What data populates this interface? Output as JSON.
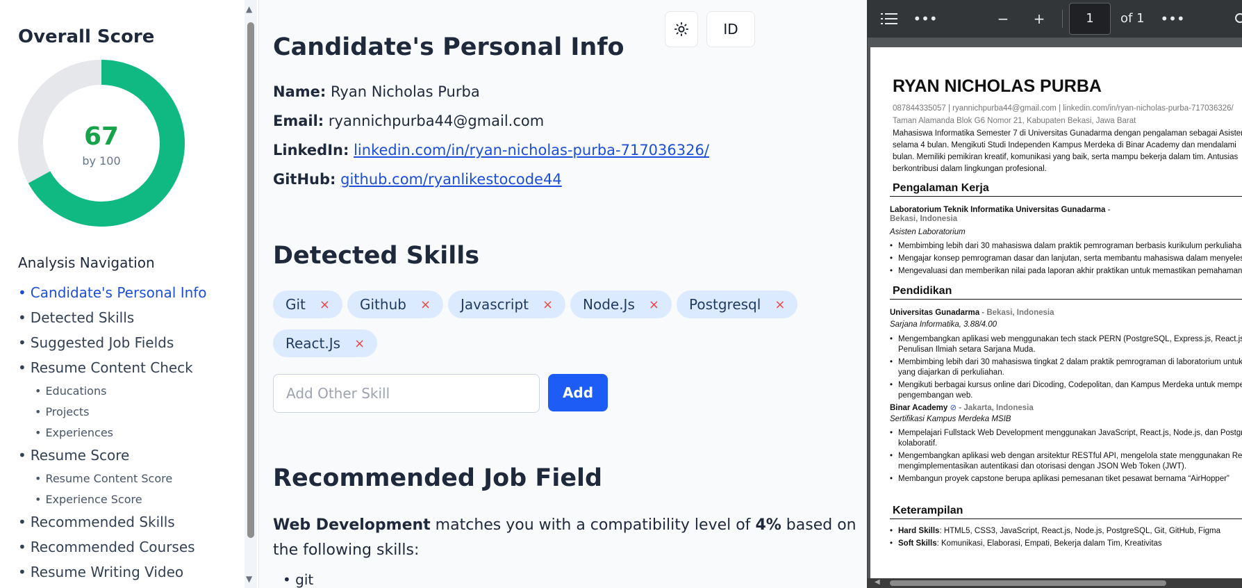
{
  "sidebar": {
    "score_title": "Overall Score",
    "score_value": "67",
    "score_max_label": "by 100",
    "score_fraction": 0.67,
    "score_color": "#10b981",
    "score_track_color": "#e5e7eb",
    "nav_title": "Analysis Navigation",
    "nav_items": [
      {
        "label": "Candidate's Personal Info",
        "level": 1,
        "active": true
      },
      {
        "label": "Detected Skills",
        "level": 1
      },
      {
        "label": "Suggested Job Fields",
        "level": 1
      },
      {
        "label": "Resume Content Check",
        "level": 1
      },
      {
        "label": "Educations",
        "level": 2
      },
      {
        "label": "Projects",
        "level": 2
      },
      {
        "label": "Experiences",
        "level": 2
      },
      {
        "label": "Resume Score",
        "level": 1
      },
      {
        "label": "Resume Content Score",
        "level": 2
      },
      {
        "label": "Experience Score",
        "level": 2
      },
      {
        "label": "Recommended Skills",
        "level": 1
      },
      {
        "label": "Recommended Courses",
        "level": 1
      },
      {
        "label": "Resume Writing Video",
        "level": 1
      }
    ]
  },
  "header": {
    "theme_icon": "sun-icon",
    "language_label": "ID"
  },
  "personal_info": {
    "title": "Candidate's Personal Info",
    "name_label": "Name:",
    "name_value": "Ryan Nicholas Purba",
    "email_label": "Email:",
    "email_value": "ryannichpurba44@gmail.com",
    "linkedin_label": "LinkedIn:",
    "linkedin_value": "linkedin.com/in/ryan-nicholas-purba-717036326/",
    "github_label": "GitHub:",
    "github_value": "github.com/ryanlikestocode44"
  },
  "skills": {
    "title": "Detected Skills",
    "chips": [
      "Git",
      "Github",
      "Javascript",
      "Node.Js",
      "Postgresql",
      "React.Js"
    ],
    "remove_symbol": "×",
    "input_placeholder": "Add Other Skill",
    "add_label": "Add"
  },
  "job_field": {
    "title": "Recommended Job Field",
    "field": "Web Development",
    "text_before": " matches you with a compatibility level of ",
    "percent": "4%",
    "text_after": " based on the following skills:",
    "skills": [
      "git"
    ]
  },
  "pdf_viewer": {
    "outline_icon": "list-icon",
    "more_icon": "more-horizontal-icon",
    "zoom_out_icon": "minus-icon",
    "zoom_in_icon": "plus-icon",
    "page_value": "1",
    "of_label": "of 1",
    "resume": {
      "name": "RYAN NICHOLAS PURBA",
      "contact": "087844335057 | ryannichpurba44@gmail.com | linkedin.com/in/ryan-nicholas-purba-717036326/",
      "address": "Taman Alamanda Blok G6 Nomor 21, Kabupaten Bekasi, Jawa Barat",
      "summary": [
        "Mahasiswa Informatika Semester 7 di Universitas Gunadarma dengan pengalaman sebagai Asisten",
        "selama 4 bulan. Mengikuti Studi Independen Kampus Merdeka di Binar Academy dan mendalami",
        "bulan. Memiliki pemikiran kreatif, komunikasi yang baik, serta mampu bekerja dalam tim. Antusias",
        "berkontribusi dalam lingkungan profesional."
      ],
      "experience_title": "Pengalaman Kerja",
      "exp_org": "Laboratorium Teknik Informatika Universitas Gunadarma",
      "exp_sep": " -",
      "exp_loc": "Bekasi, Indonesia",
      "exp_role": "Asisten Laboratorium",
      "exp_bullets": [
        "Membimbing lebih dari 30 mahasiswa dalam praktik pemrograman berbasis kurikulum perkuliahan",
        "Mengajar konsep pemrograman dasar dan lanjutan, serta membantu mahasiswa dalam menyelesaikan",
        "Mengevaluasi dan memberikan nilai pada laporan akhir praktikan untuk memastikan pemahaman"
      ],
      "education_title": "Pendidikan",
      "edu1_org": "Universitas Gunadarma",
      "edu1_loc": " - Bekasi, Indonesia",
      "edu1_role": "Sarjana Informatika, 3.88/4.00",
      "edu1_bullets": [
        [
          "Mengembangkan aplikasi web menggunakan tech stack PERN (PostgreSQL, Express.js, React.js,",
          "Penulisan Ilmiah setara Sarjana Muda."
        ],
        [
          "Membimbing lebih dari 30 mahasiswa tingkat 2 dalam praktik pemrograman di laboratorium untuk",
          "yang diajarkan di perkuliahan."
        ],
        [
          "Mengikuti berbagai kursus online dari Dicoding, Codepolitan, dan Kampus Merdeka untuk memperdalam",
          "pengembangan web."
        ]
      ],
      "edu2_org": "Binar Academy",
      "edu2_loc": " - Jakarta, Indonesia",
      "edu2_role": "Sertifikasi Kampus Merdeka MSIB",
      "edu2_bullets": [
        [
          "Mempelajari Fullstack Web Development menggunakan JavaScript, React.js, Node.js, dan PostgreSQL",
          "kolaboratif."
        ],
        [
          "Mengembangkan aplikasi web dengan arsitektur RESTful API, mengelola state menggunakan Redux,",
          "mengimplementasikan autentikasi dan otorisasi dengan JSON Web Token (JWT)."
        ],
        [
          "Membangun proyek capstone berupa aplikasi pemesanan tiket pesawat bernama “AirHopper”"
        ]
      ],
      "skills_title": "Keterampilan",
      "hard_label": "Hard Skills",
      "hard_value": ": HTML5, CSS3, JavaScript, React.js, Node.js, PostgreSQL, Git, GitHub, Figma",
      "soft_label": "Soft Skills",
      "soft_value": ": Komunikasi, Elaborasi, Empati, Bekerja dalam Tim, Kreativitas"
    }
  }
}
